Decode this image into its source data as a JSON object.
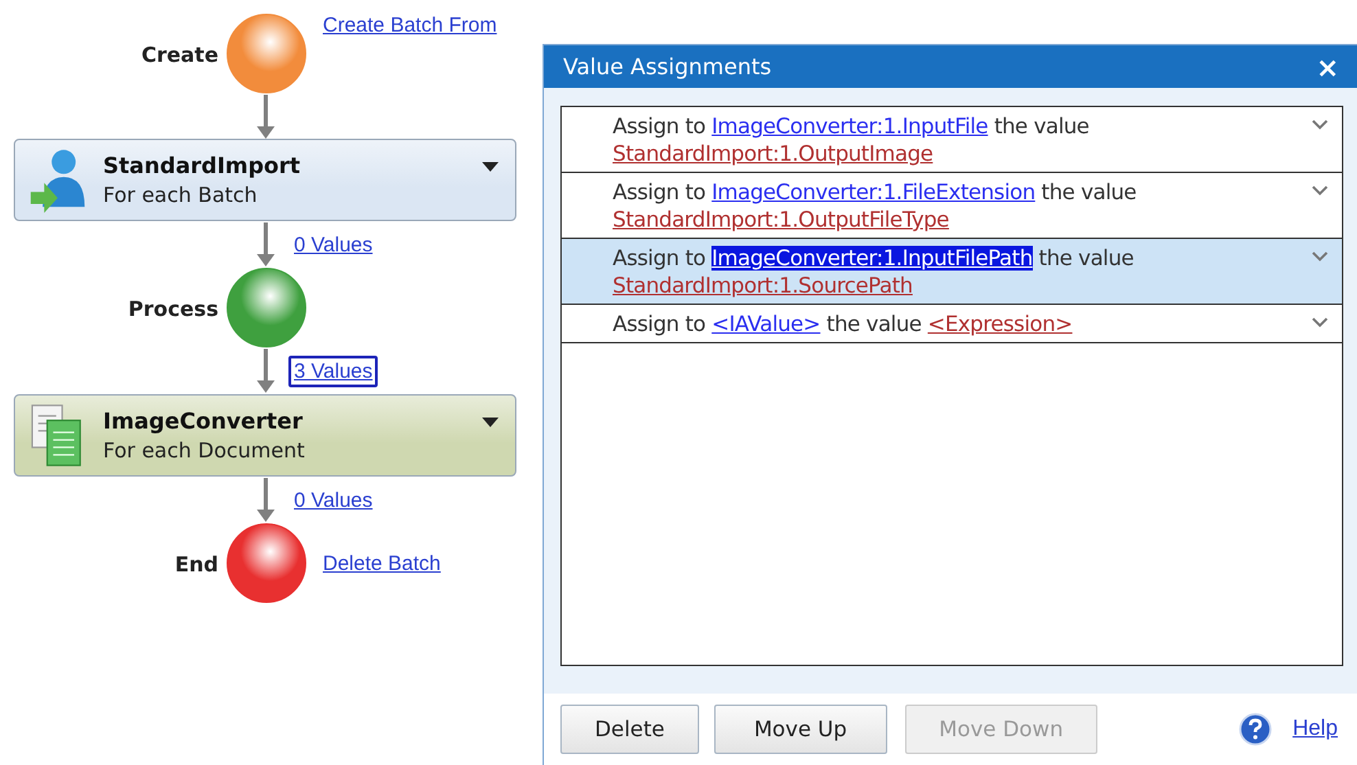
{
  "flow": [
    {
      "kind": "state",
      "label": "Create",
      "color": "#f28c3c",
      "link": "Create Batch From"
    },
    {
      "kind": "step",
      "title": "StandardImport",
      "subtitle": "For each Batch",
      "color": "#dbe6f3"
    },
    {
      "kind": "connector",
      "link": "0 Values",
      "selected": false
    },
    {
      "kind": "state",
      "label": "Process",
      "color": "#3fa03f"
    },
    {
      "kind": "connector",
      "link": "3 Values",
      "selected": true
    },
    {
      "kind": "step",
      "title": "ImageConverter",
      "subtitle": "For each Document",
      "color": "#cfd8b0"
    },
    {
      "kind": "connector",
      "link": "0 Values",
      "selected": false
    },
    {
      "kind": "state",
      "label": "End",
      "color": "#e83030",
      "link": "Delete Batch"
    }
  ],
  "dialog": {
    "title": "Value Assignments",
    "close": "×",
    "rows": [
      {
        "prefix": "Assign to",
        "target": "ImageConverter:1.InputFile",
        "middle": "the value",
        "source": "StandardImport:1.OutputImage",
        "selected": false
      },
      {
        "prefix": "Assign to",
        "target": "ImageConverter:1.FileExtension",
        "middle": "the value",
        "source": "StandardImport:1.OutputFileType",
        "selected": false
      },
      {
        "prefix": "Assign to",
        "target": "ImageConverter:1.InputFilePath",
        "middle": "the value",
        "source": "StandardImport:1.SourcePath",
        "selected": true
      },
      {
        "prefix": "Assign to",
        "target": "<IAValue>",
        "middle": "the value",
        "source": "<Expression>",
        "selected": false
      }
    ],
    "buttons": [
      {
        "label": "Delete",
        "disabled": false
      },
      {
        "label": "Move Up",
        "disabled": false
      },
      {
        "label": "Move Down",
        "disabled": true
      }
    ],
    "help": "Help"
  }
}
